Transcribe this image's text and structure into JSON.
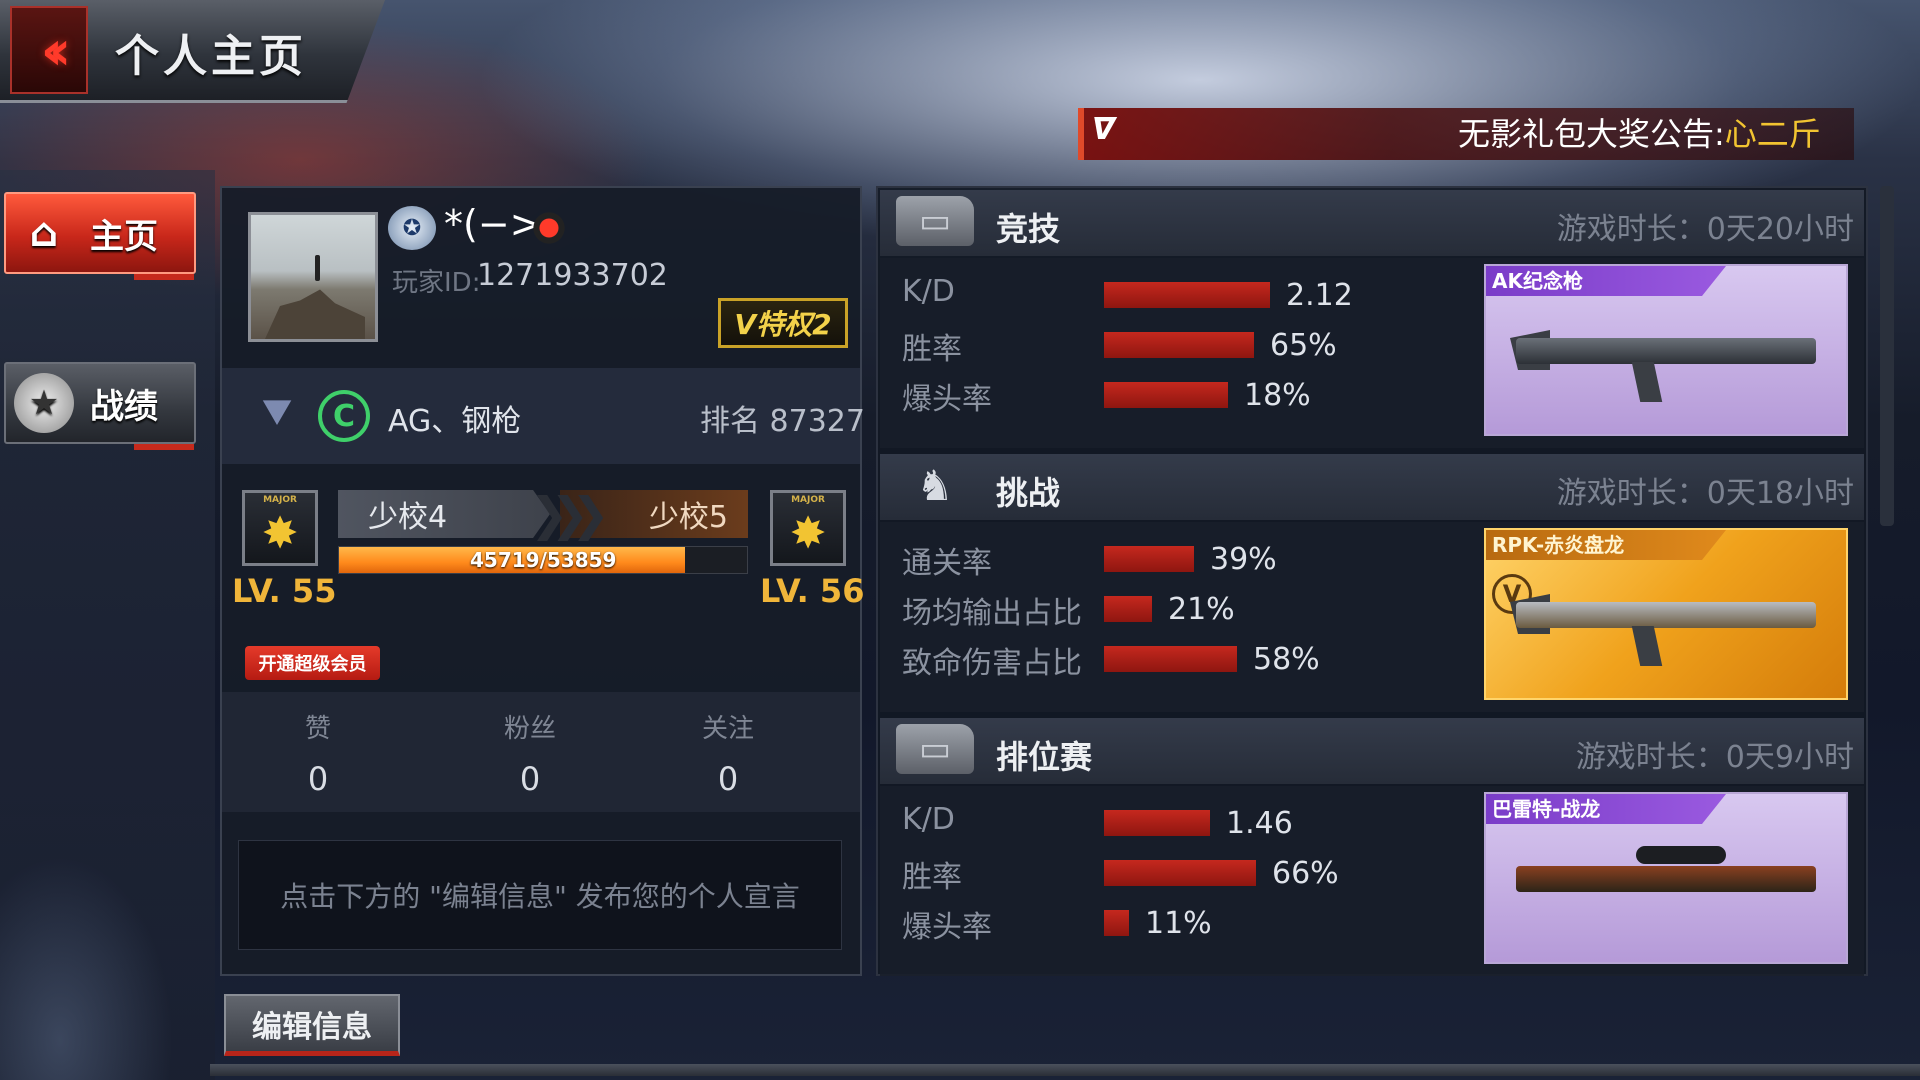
{
  "header": {
    "title": "个人主页",
    "back_icon": "double-chevron-left-icon"
  },
  "announcement": {
    "logo": "CF",
    "prefix": "无影礼包大奖公告:",
    "highlight": "心二斤"
  },
  "nav": [
    {
      "label": "主页",
      "icon": "home-icon",
      "active": true
    },
    {
      "label": "战绩",
      "icon": "star-badge-icon",
      "active": false
    }
  ],
  "profile": {
    "name": "*(−>",
    "id_label": "玩家ID:",
    "id": "1271933702",
    "vip_badge": "V特权2",
    "clan": {
      "name": "AG、钢枪",
      "rank": "排名 87327"
    },
    "level": {
      "current_rank": "少校4",
      "next_rank": "少校5",
      "current_lv": "LV. 55",
      "next_lv": "LV. 56",
      "emblem_tag": "MAJOR",
      "xp": 45719,
      "xp_max": 53859,
      "xp_text": "45719/53859"
    },
    "svip_button": "开通超级会员",
    "stats": [
      {
        "label": "赞",
        "value": "0"
      },
      {
        "label": "粉丝",
        "value": "0"
      },
      {
        "label": "关注",
        "value": "0"
      }
    ],
    "motto_placeholder": "点击下方的 \"编辑信息\" 发布您的个人宣言",
    "edit_button": "编辑信息"
  },
  "modes": [
    {
      "name": "竞技",
      "icon": "ticket-icon",
      "playtime": "游戏时长：0天20小时",
      "stats": [
        {
          "label": "K/D",
          "value": "2.12",
          "level": 0.72
        },
        {
          "label": "胜率",
          "value": "65%",
          "level": 0.65
        },
        {
          "label": "爆头率",
          "value": "18%",
          "level": 0.54
        }
      ],
      "weapon": {
        "name": "AK纪念枪",
        "style": "purple"
      }
    },
    {
      "name": "挑战",
      "icon": "monster-icon",
      "playtime": "游戏时长：0天18小时",
      "stats": [
        {
          "label": "通关率",
          "value": "39%",
          "level": 0.39
        },
        {
          "label": "场均输出占比",
          "value": "21%",
          "level": 0.21
        },
        {
          "label": "致命伤害占比",
          "value": "58%",
          "level": 0.58
        }
      ],
      "weapon": {
        "name": "RPK-赤炎盘龙",
        "style": "gold"
      }
    },
    {
      "name": "排位赛",
      "icon": "ticket-icon",
      "playtime": "游戏时长：0天9小时",
      "stats": [
        {
          "label": "K/D",
          "value": "1.46",
          "level": 0.46
        },
        {
          "label": "胜率",
          "value": "66%",
          "level": 0.66
        },
        {
          "label": "爆头率",
          "value": "11%",
          "level": 0.11
        }
      ],
      "weapon": {
        "name": "巴雷特-战龙",
        "style": "purple"
      }
    }
  ],
  "colors": {
    "accent_red": "#c5281e",
    "xp_orange": "#ff8a1c",
    "level_gold": "#f0b53a",
    "highlight_yellow": "#f2c431"
  }
}
